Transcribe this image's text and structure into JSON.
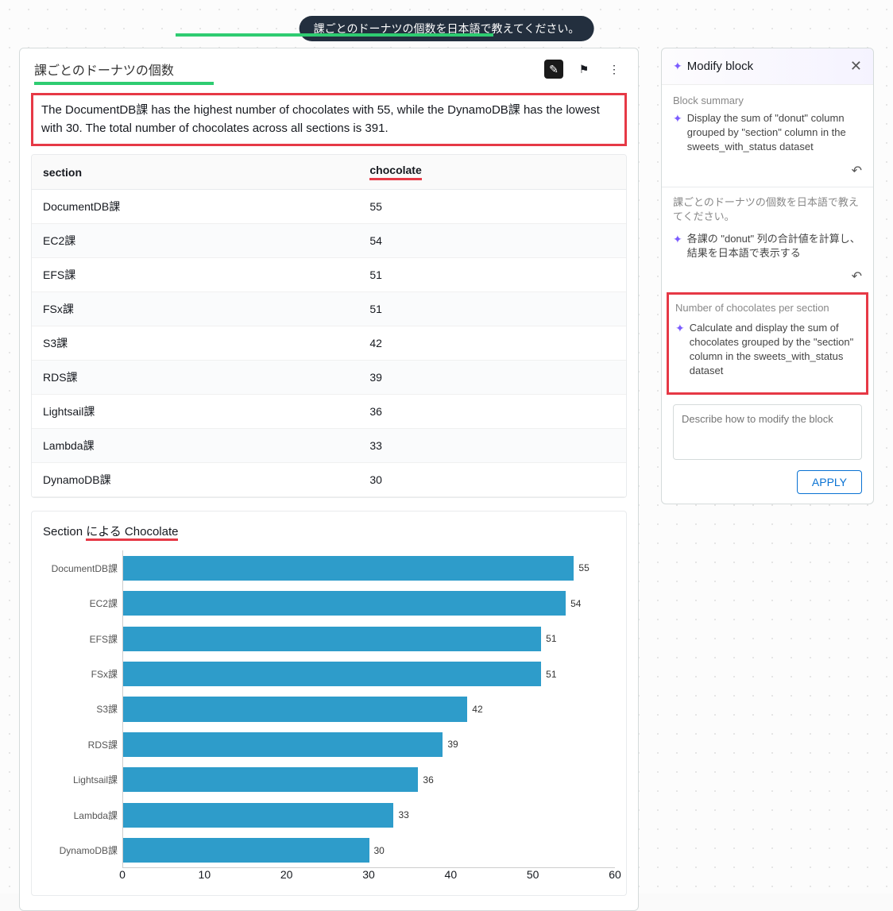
{
  "pill_text": "課ごとのドーナツの個数を日本語で教えてください。",
  "card": {
    "title": "課ごとのドーナツの個数",
    "summary": "The DocumentDB課 has the highest number of chocolates with 55, while the DynamoDB課 has the lowest with 30. The total number of chocolates across all sections is 391."
  },
  "table": {
    "col_section": "section",
    "col_chocolate": "chocolate",
    "rows": [
      {
        "section": "DocumentDB課",
        "chocolate": "55"
      },
      {
        "section": "EC2課",
        "chocolate": "54"
      },
      {
        "section": "EFS課",
        "chocolate": "51"
      },
      {
        "section": "FSx課",
        "chocolate": "51"
      },
      {
        "section": "S3課",
        "chocolate": "42"
      },
      {
        "section": "RDS課",
        "chocolate": "39"
      },
      {
        "section": "Lightsail課",
        "chocolate": "36"
      },
      {
        "section": "Lambda課",
        "chocolate": "33"
      },
      {
        "section": "DynamoDB課",
        "chocolate": "30"
      }
    ]
  },
  "chart_data": {
    "type": "bar",
    "orientation": "horizontal",
    "title_pre": "Section ",
    "title_mid": "による Chocolate",
    "categories": [
      "DocumentDB課",
      "EC2課",
      "EFS課",
      "FSx課",
      "S3課",
      "RDS課",
      "Lightsail課",
      "Lambda課",
      "DynamoDB課"
    ],
    "values": [
      55,
      54,
      51,
      51,
      42,
      39,
      36,
      33,
      30
    ],
    "xlim": [
      0,
      60
    ],
    "xticks": [
      0,
      10,
      20,
      30,
      40,
      50,
      60
    ],
    "xlabel": "",
    "ylabel": ""
  },
  "side": {
    "title": "Modify block",
    "summary_label": "Block summary",
    "summary_text": "Display the sum of \"donut\" column grouped by \"section\" column in the sweets_with_status dataset",
    "prompt1_gray": "課ごとのドーナツの個数を日本語で教えてください。",
    "prompt1_item": "各課の \"donut\" 列の合計値を計算し、結果を日本語で表示する",
    "box_gray": "Number of chocolates per section",
    "box_item": "Calculate and display the sum of chocolates grouped by the \"section\" column in the sweets_with_status dataset",
    "input_placeholder": "Describe how to modify the block",
    "apply_label": "APPLY"
  },
  "icons": {
    "edit": "✎",
    "flag": "⚑",
    "more": "⋮",
    "close": "✕",
    "undo": "↶",
    "sparkle": "✦"
  }
}
